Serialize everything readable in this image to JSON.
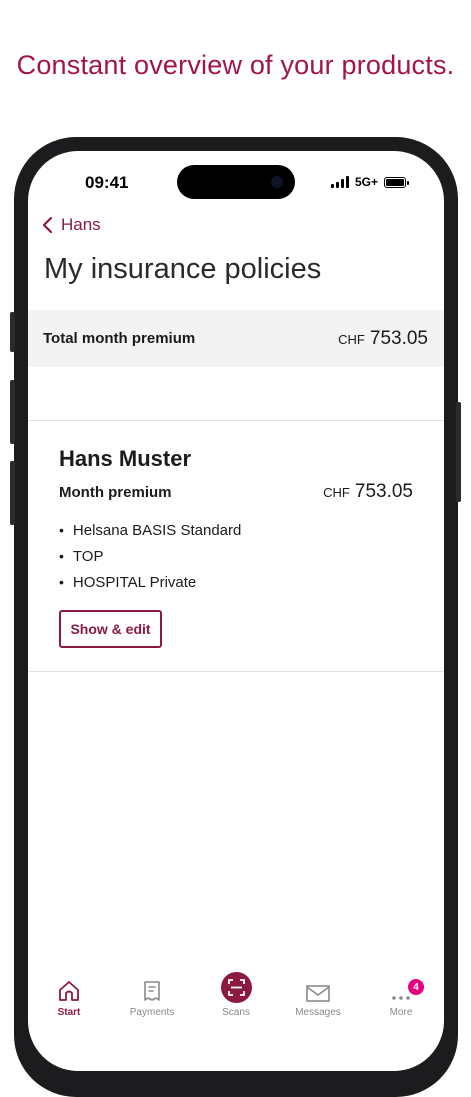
{
  "headline": "Constant overview of your products.",
  "status_bar": {
    "time": "09:41",
    "network": "5G+"
  },
  "nav": {
    "back_label": "Hans"
  },
  "page": {
    "title": "My insurance policies"
  },
  "total": {
    "label": "Total month premium",
    "currency": "CHF",
    "amount": "753.05"
  },
  "policy": {
    "name": "Hans Muster",
    "premium_label": "Month premium",
    "currency": "CHF",
    "amount": "753.05",
    "products": [
      "Helsana BASIS Standard",
      "TOP",
      "HOSPITAL Private"
    ],
    "edit_label": "Show & edit"
  },
  "tabbar": {
    "items": [
      {
        "label": "Start",
        "icon": "home-icon",
        "active": true
      },
      {
        "label": "Payments",
        "icon": "receipt-icon",
        "active": false
      },
      {
        "label": "Scans",
        "icon": "scan-icon",
        "active": false
      },
      {
        "label": "Messages",
        "icon": "mail-icon",
        "active": false
      },
      {
        "label": "More",
        "icon": "more-icon",
        "active": false,
        "badge": "4"
      }
    ]
  },
  "colors": {
    "brand": "#8c1a40",
    "headline": "#a3154a",
    "badge": "#e4007f",
    "band": "#f3f3f3"
  }
}
